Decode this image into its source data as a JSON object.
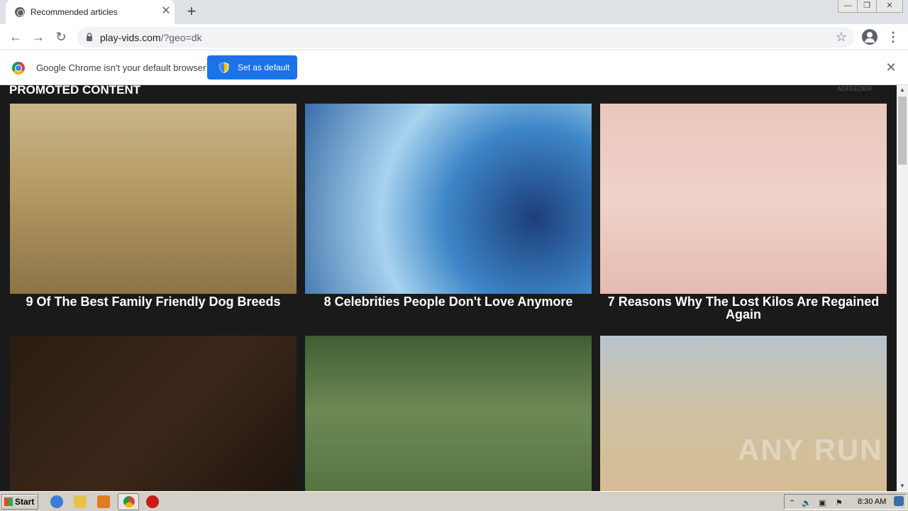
{
  "browser": {
    "tab_title": "Recommended articles",
    "tab_close": "✕",
    "new_tab": "+",
    "window_buttons": [
      "—",
      "❐",
      "✕"
    ],
    "url_host": "play-vids.com",
    "url_rest": "/?geo=dk"
  },
  "infobar": {
    "message": "Google Chrome isn't your default browser",
    "button_label": "Set as default",
    "close": "✕"
  },
  "page": {
    "heading": "PROMOTED CONTENT",
    "feeder_logo": "ADFEEDER",
    "cards": [
      {
        "title": "9 Of The Best Family Friendly Dog Breeds"
      },
      {
        "title": "8 Celebrities People Don't Love Anymore"
      },
      {
        "title": "7 Reasons Why The Lost Kilos Are Regained Again"
      },
      {
        "title": ""
      },
      {
        "title": ""
      },
      {
        "title": ""
      }
    ],
    "watermark": "ANY RUN"
  },
  "taskbar": {
    "start_label": "Start",
    "clock": "8:30 AM"
  }
}
